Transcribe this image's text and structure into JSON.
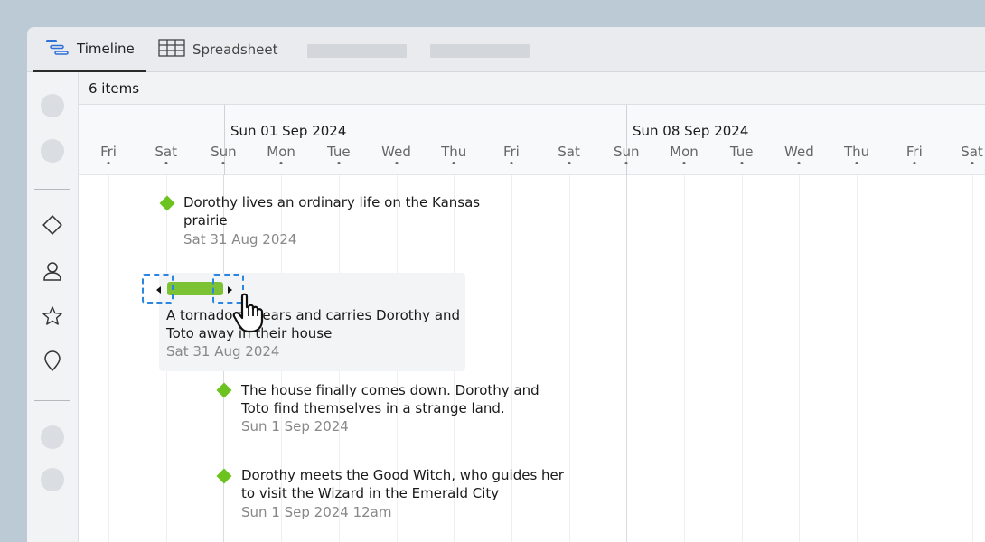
{
  "tabs": [
    {
      "label": "Timeline",
      "icon": "timeline-icon",
      "active": true
    },
    {
      "label": "Spreadsheet",
      "icon": "spreadsheet-icon",
      "active": false
    }
  ],
  "item_count": "6 items",
  "sidebar_icons": [
    "diamond-icon",
    "person-icon",
    "star-icon",
    "location-pin-icon"
  ],
  "header": {
    "weeks": [
      "Sun 01 Sep 2024",
      "Sun 08 Sep 2024"
    ],
    "days": [
      "Fri",
      "Sat",
      "Sun",
      "Mon",
      "Tue",
      "Wed",
      "Thu",
      "Fri",
      "Sat",
      "Sun",
      "Mon",
      "Tue",
      "Wed",
      "Thu",
      "Fri",
      "Sat"
    ]
  },
  "items": [
    {
      "title_lines": [
        "Dorothy lives an ordinary life on the Kansas",
        "prairie"
      ],
      "date": "Sat 31 Aug 2024",
      "type": "milestone"
    },
    {
      "title_lines": [
        "A tornado appears and carries Dorothy and",
        "Toto away in their house"
      ],
      "date": "Sat 31 Aug 2024",
      "type": "task",
      "selected": true
    },
    {
      "title_lines": [
        "The house finally comes down. Dorothy and",
        "Toto find themselves in a strange land."
      ],
      "date": "Sun 1 Sep 2024",
      "type": "milestone"
    },
    {
      "title_lines": [
        "Dorothy meets the Good Witch, who guides her",
        "to visit the Wizard in the Emerald City"
      ],
      "date": "Sun 1 Sep 2024 12am",
      "type": "milestone"
    }
  ],
  "colors": {
    "milestone": "#6cc21f",
    "task_bar": "#7cc235",
    "handle_border": "#2b86e0",
    "background": "#bccad6"
  }
}
